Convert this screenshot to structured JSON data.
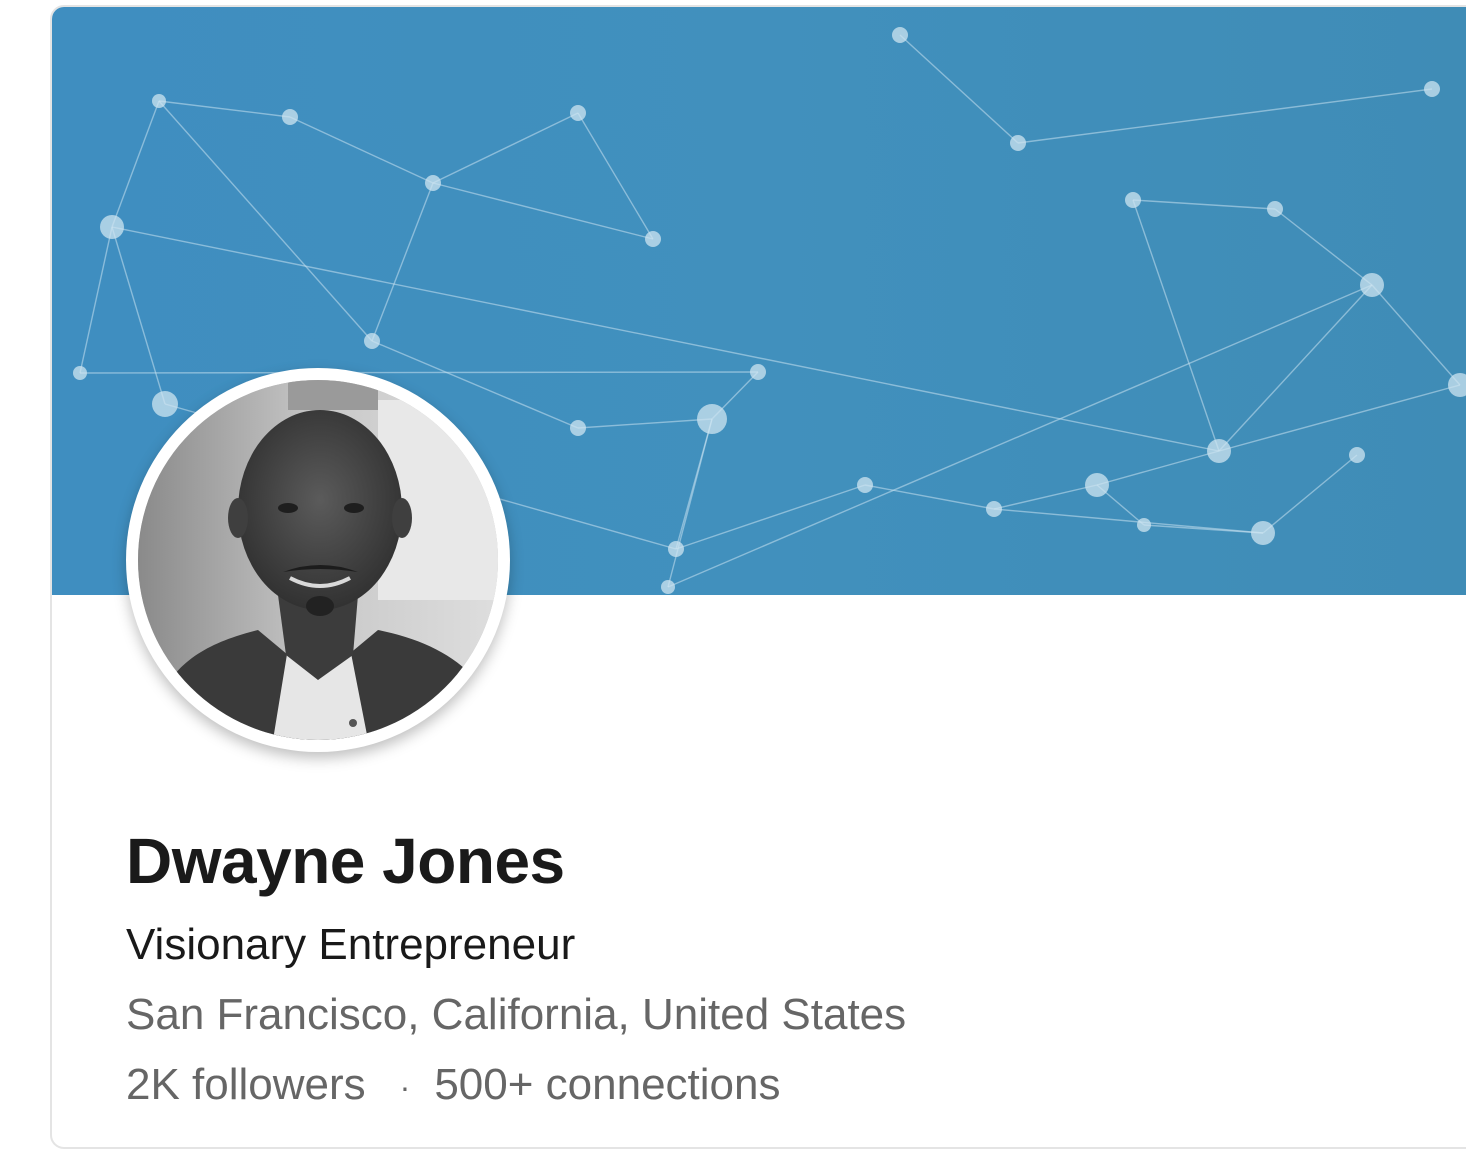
{
  "profile": {
    "name": "Dwayne Jones",
    "headline": "Visionary Entrepreneur",
    "location": "San Francisco, California, United States",
    "followers": "2K followers",
    "separator": "·",
    "connections": "500+ connections"
  },
  "cover": {
    "pattern": "network-nodes",
    "color": "#4190bd"
  },
  "colors": {
    "name": "#1a1a1a",
    "headline": "#191919",
    "secondary": "#666666",
    "card_border": "#e4e4e4"
  }
}
